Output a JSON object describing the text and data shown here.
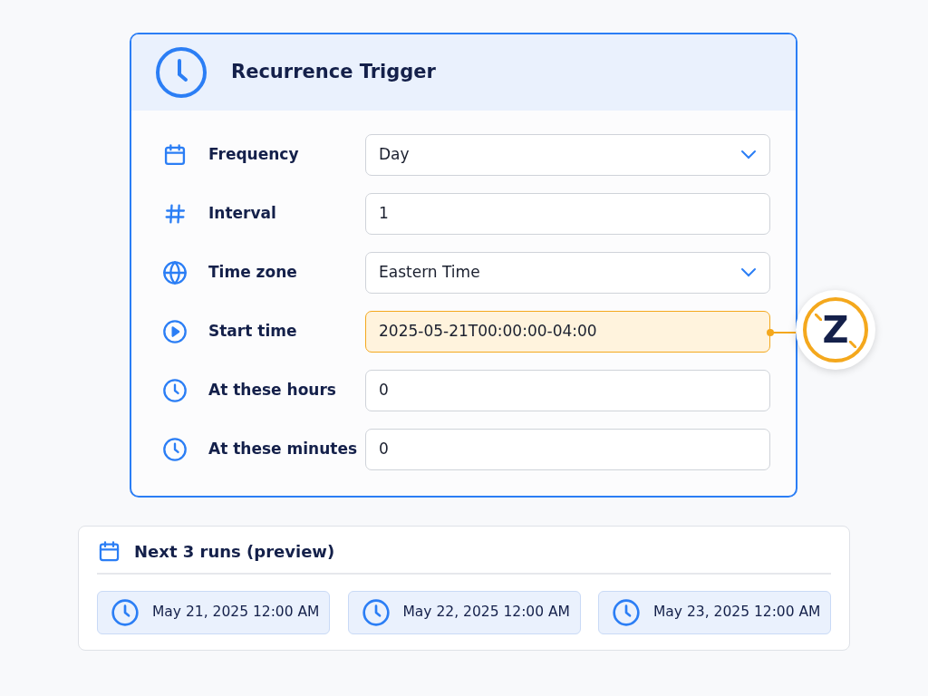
{
  "trigger": {
    "title": "Recurrence Trigger",
    "fields": [
      {
        "label": "Frequency",
        "kind": "select",
        "value": "Day",
        "highlighted": false
      },
      {
        "label": "Interval",
        "kind": "input",
        "value": "1",
        "highlighted": false
      },
      {
        "label": "Time zone",
        "kind": "select",
        "value": "Eastern Time",
        "highlighted": false
      },
      {
        "label": "Start time",
        "kind": "input",
        "value": "2025-05-21T00:00:00-04:00",
        "highlighted": true
      },
      {
        "label": "At these hours",
        "kind": "input",
        "value": "0",
        "highlighted": false
      },
      {
        "label": "At these minutes",
        "kind": "input",
        "value": "0",
        "highlighted": false
      }
    ],
    "callout_badge": "Z"
  },
  "preview": {
    "title": "Next 3 runs (preview)",
    "runs": [
      "May 21, 2025 12:00 AM",
      "May 22, 2025 12:00 AM",
      "May 23, 2025 12:00 AM"
    ]
  }
}
